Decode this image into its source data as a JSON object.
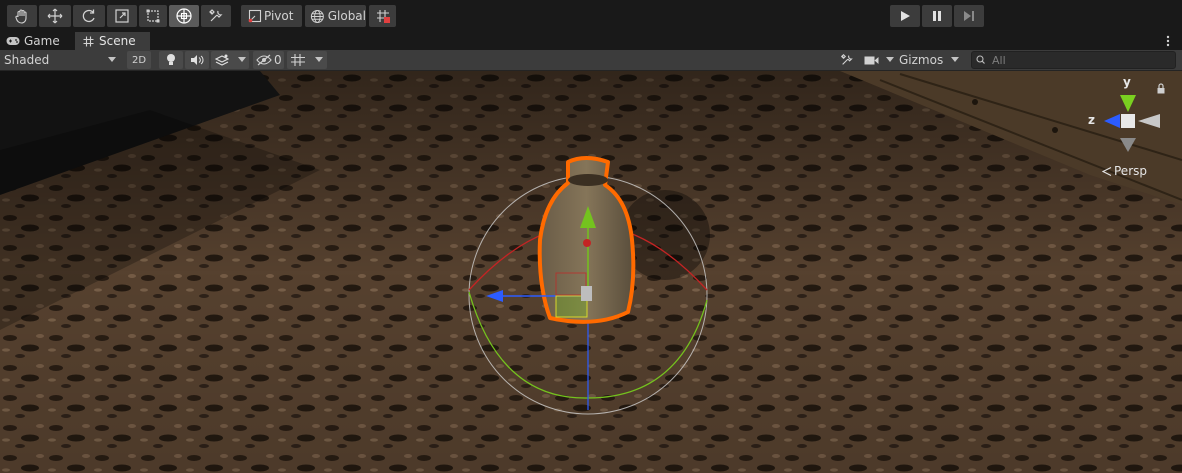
{
  "toolbar": {
    "tools": [
      "hand-tool",
      "move-tool",
      "rotate-tool",
      "scale-tool",
      "rect-tool",
      "transform-tool",
      "custom-tool"
    ],
    "active_tool": "transform-tool",
    "pivot_label": "Pivot",
    "global_label": "Global",
    "playback": [
      "play",
      "pause",
      "step"
    ]
  },
  "tabs": [
    {
      "label": "Game",
      "icon": "gamepad-icon",
      "active": false
    },
    {
      "label": "Scene",
      "icon": "grid-icon",
      "active": true
    }
  ],
  "scene_bar": {
    "shading_mode": "Shaded",
    "mode_2d": "2D",
    "hidden_count": "0",
    "gizmos_label": "Gizmos",
    "search_placeholder": "All"
  },
  "viewport": {
    "projection_label": "Persp",
    "axis_labels": {
      "y": "y",
      "z": "z"
    }
  },
  "colors": {
    "selection_outline": "#ff6a00",
    "axis_x": "#d23030",
    "axis_y": "#7ad020",
    "axis_z": "#2c5cff"
  }
}
